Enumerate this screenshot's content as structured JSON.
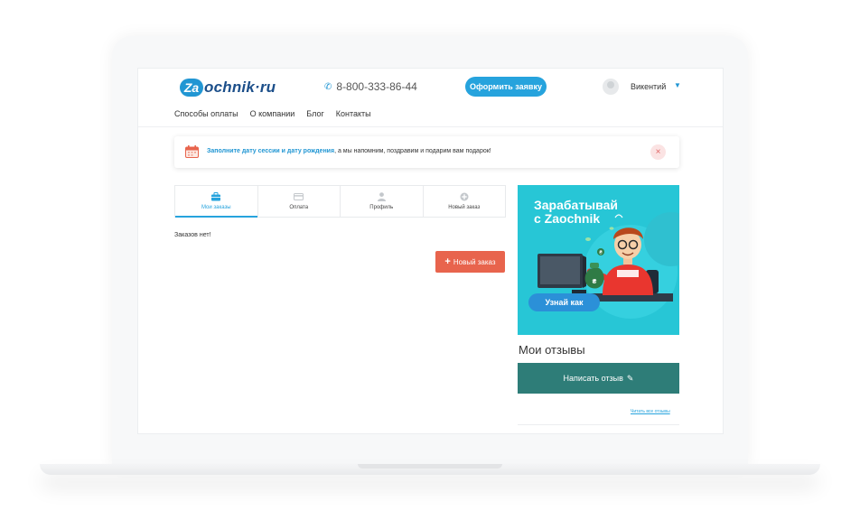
{
  "header": {
    "logo_badge": "Za",
    "logo_text": "ochnik·ru",
    "phone": "8-800-333-86-44",
    "order_button": "Оформить заявку",
    "user_name": "Викентий"
  },
  "nav": {
    "items": [
      "Способы оплаты",
      "О компании",
      "Блог",
      "Контакты"
    ]
  },
  "notice": {
    "link_text": "Заполните дату сессии и дату рождения",
    "rest_text": ", а мы напомним, поздравим и подарим вам подарок!",
    "close": "×"
  },
  "tabs": [
    {
      "label": "Мои заказы",
      "icon": "briefcase-icon",
      "active": true
    },
    {
      "label": "Оплата",
      "icon": "credit-card-icon",
      "active": false
    },
    {
      "label": "Профиль",
      "icon": "user-icon",
      "active": false
    },
    {
      "label": "Новый заказ",
      "icon": "plus-circle-icon",
      "active": false
    }
  ],
  "orders": {
    "empty_text": "Заказов нет!",
    "new_order_button": "Новый заказ"
  },
  "banner": {
    "title": "Зарабатывай\nс Zaochnik",
    "button": "Узнай как"
  },
  "reviews": {
    "title": "Мои отзывы",
    "write_button": "Написать отзыв",
    "read_all": "Читать все отзывы"
  },
  "colors": {
    "primary": "#26a3dd",
    "danger": "#e8644d",
    "teal": "#2e7d78",
    "banner": "#27c6d6"
  }
}
